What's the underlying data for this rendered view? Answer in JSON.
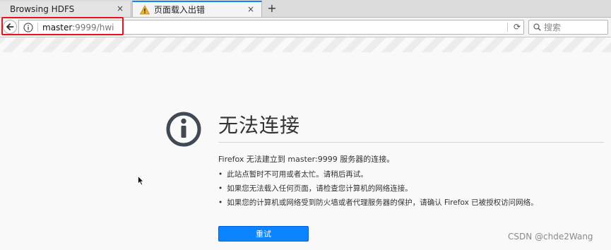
{
  "tabs": [
    {
      "label": "Browsing HDFS",
      "close": "×"
    },
    {
      "label": "页面载入出错",
      "close": "×"
    }
  ],
  "new_tab_label": "+",
  "address": {
    "host": "master",
    "rest": ":9999/hwi"
  },
  "reload_glyph": "⟳",
  "search_placeholder": "搜索",
  "error": {
    "title": "无法连接",
    "description": "Firefox 无法建立到 master:9999 服务器的连接。",
    "bullets": [
      "此站点暂时不可用或者太忙。请稍后再试。",
      "如果您无法载入任何页面，请检查您计算机的网络连接。",
      "如果您的计算机或网络受到防火墙或者代理服务器的保护，请确认 Firefox 已被授权访问网络。"
    ],
    "retry_label": "重试"
  },
  "watermark": "CSDN @chde2Wang",
  "colors": {
    "accent": "#0a84ff",
    "highlight": "#e8111d",
    "warning": "#f0b030"
  }
}
